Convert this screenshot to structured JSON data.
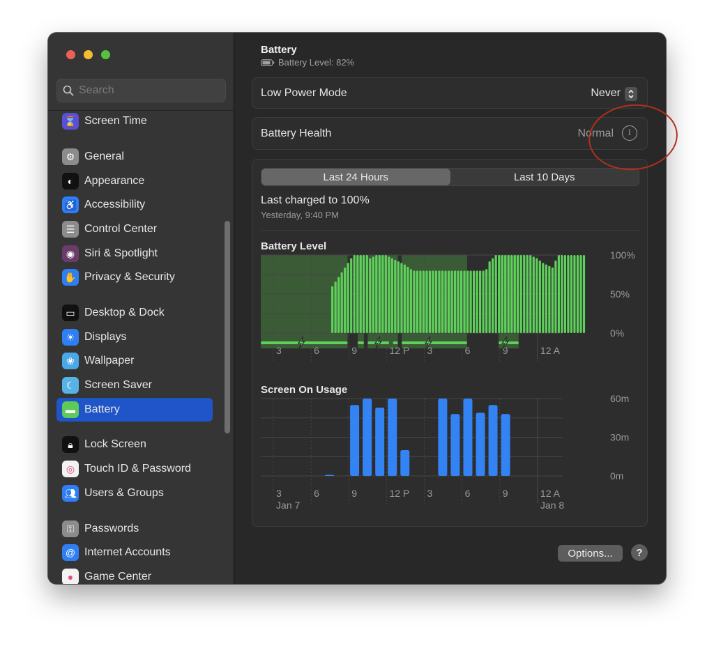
{
  "window": {
    "traffic_lights": [
      {
        "name": "close",
        "color": "#ee5f57"
      },
      {
        "name": "minimize",
        "color": "#f4bd30"
      },
      {
        "name": "zoom",
        "color": "#58c13f"
      }
    ]
  },
  "sidebar": {
    "search_placeholder": "Search",
    "items": [
      {
        "label": "Screen Time",
        "icon": "hourglass-icon",
        "glyph": "⌛",
        "color": "#5b4fd6",
        "selected": false
      },
      {
        "label": "General",
        "icon": "gear-icon",
        "glyph": "⚙",
        "color": "#8c8c8c",
        "selected": false
      },
      {
        "label": "Appearance",
        "icon": "appearance-icon",
        "glyph": "◐",
        "color": "#111111",
        "selected": false
      },
      {
        "label": "Accessibility",
        "icon": "accessibility-icon",
        "glyph": "♿",
        "color": "#2f7ef4",
        "selected": false
      },
      {
        "label": "Control Center",
        "icon": "control-center-icon",
        "glyph": "☰",
        "color": "#8c8c8c",
        "selected": false
      },
      {
        "label": "Siri & Spotlight",
        "icon": "siri-icon",
        "glyph": "◉",
        "color": "#6b3b6a",
        "selected": false
      },
      {
        "label": "Privacy & Security",
        "icon": "hand-icon",
        "glyph": "✋",
        "color": "#2f7ef4",
        "selected": false
      },
      {
        "label": "Desktop & Dock",
        "icon": "dock-icon",
        "glyph": "▭",
        "color": "#111111",
        "selected": false
      },
      {
        "label": "Displays",
        "icon": "sun-icon",
        "glyph": "☀",
        "color": "#2f7ef4",
        "selected": false
      },
      {
        "label": "Wallpaper",
        "icon": "flower-icon",
        "glyph": "❀",
        "color": "#4aa8e8",
        "selected": false
      },
      {
        "label": "Screen Saver",
        "icon": "screen-saver-icon",
        "glyph": "☾",
        "color": "#58b2e6",
        "selected": false
      },
      {
        "label": "Battery",
        "icon": "battery-icon",
        "glyph": "▬",
        "color": "#5dcb5a",
        "selected": true
      },
      {
        "label": "Lock Screen",
        "icon": "lock-icon",
        "glyph": "🔒︎",
        "color": "#111111",
        "selected": false
      },
      {
        "label": "Touch ID & Password",
        "icon": "fingerprint-icon",
        "glyph": "◎",
        "color": "#f2f2f2",
        "selected": false
      },
      {
        "label": "Users & Groups",
        "icon": "users-icon",
        "glyph": "👥︎",
        "color": "#2f7ef4",
        "selected": false
      },
      {
        "label": "Passwords",
        "icon": "key-icon",
        "glyph": "⚿",
        "color": "#8c8c8c",
        "selected": false
      },
      {
        "label": "Internet Accounts",
        "icon": "at-icon",
        "glyph": "@",
        "color": "#2f7ef4",
        "selected": false
      },
      {
        "label": "Game Center",
        "icon": "game-center-icon",
        "glyph": "●",
        "color": "#f2f2f2",
        "selected": false
      }
    ]
  },
  "main": {
    "title": "Battery",
    "subtitle": "Battery Level: 82%",
    "low_power_mode": {
      "label": "Low Power Mode",
      "value": "Never"
    },
    "battery_health": {
      "label": "Battery Health",
      "value": "Normal"
    },
    "tabs": [
      {
        "label": "Last 24 Hours",
        "active": true
      },
      {
        "label": "Last 10 Days",
        "active": false
      }
    ],
    "last_charged": {
      "title": "Last charged to 100%",
      "time": "Yesterday, 9:40 PM"
    },
    "options_label": "Options...",
    "help_label": "?"
  },
  "colors": {
    "accent": "#1f55c9",
    "battery_green": "#5fd05c",
    "usage_blue": "#3483f5",
    "annotation_red": "#b0301f"
  },
  "chart_data": [
    {
      "type": "bar",
      "title": "Battery Level",
      "ylabel": "",
      "ylim": [
        0,
        100
      ],
      "y_ticks": [
        "100%",
        "50%",
        "0%"
      ],
      "x_ticks": [
        "3",
        "6",
        "9",
        "12 P",
        "3",
        "6",
        "9",
        "12 A"
      ],
      "x_range_hours": [
        2,
        26
      ],
      "grid": true,
      "bar_interval_hours": 0.25,
      "start_hour": 7.6,
      "values": [
        60,
        66,
        72,
        78,
        84,
        90,
        96,
        100,
        100,
        100,
        100,
        100,
        96,
        98,
        100,
        100,
        100,
        100,
        98,
        96,
        94,
        92,
        90,
        88,
        85,
        82,
        80,
        80,
        80,
        80,
        80,
        80,
        80,
        80,
        80,
        80,
        80,
        80,
        80,
        80,
        80,
        80,
        80,
        80,
        80,
        80,
        80,
        80,
        80,
        82,
        92,
        96,
        100,
        100,
        100,
        100,
        100,
        100,
        100,
        100,
        100,
        100,
        100,
        100,
        98,
        96,
        93,
        90,
        88,
        86,
        84,
        93,
        100,
        100,
        100,
        100,
        100,
        100,
        100,
        100,
        100
      ],
      "charging_periods_hours": [
        [
          2.0,
          8.9
        ],
        [
          9.7,
          10.2
        ],
        [
          10.5,
          12.2
        ],
        [
          12.5,
          12.9
        ],
        [
          13.2,
          18.4
        ],
        [
          20.9,
          22.5
        ]
      ],
      "shaded_periods_hours": [
        [
          2.0,
          8.9
        ],
        [
          9.7,
          10.2
        ],
        [
          10.5,
          12.9
        ],
        [
          13.2,
          18.4
        ],
        [
          20.9,
          22.5
        ]
      ]
    },
    {
      "type": "bar",
      "title": "Screen On Usage",
      "ylabel": "",
      "ylim": [
        0,
        60
      ],
      "y_ticks": [
        "60m",
        "30m",
        "0m"
      ],
      "x_ticks": [
        "3",
        "6",
        "9",
        "12 P",
        "3",
        "6",
        "9",
        "12 A"
      ],
      "date_labels": [
        "Jan 7",
        "Jan 8"
      ],
      "x_range_hours": [
        2,
        26
      ],
      "grid": true,
      "hours": [
        7,
        9,
        10,
        11,
        12,
        13,
        16,
        17,
        18,
        19,
        20,
        21
      ],
      "values": [
        0.5,
        55,
        60,
        53,
        60,
        20,
        60,
        48,
        60,
        49,
        55,
        48
      ]
    }
  ]
}
